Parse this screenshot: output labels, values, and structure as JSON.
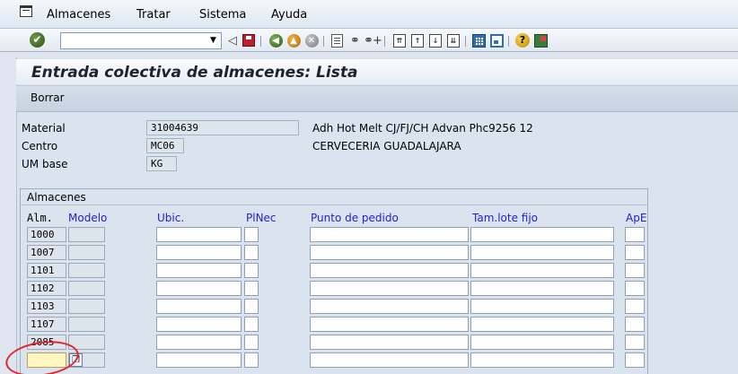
{
  "menu": {
    "items": [
      "Almacenes",
      "Tratar",
      "Sistema",
      "Ayuda"
    ]
  },
  "toolbar": {
    "command_field": "",
    "icons": [
      "enter-icon",
      "back-triangle-icon",
      "save-icon",
      "back-icon",
      "exit-icon",
      "cancel-icon",
      "print-icon",
      "find-icon",
      "find-next-icon",
      "first-page-icon",
      "previous-page-icon",
      "next-page-icon",
      "last-page-icon",
      "create-session-icon",
      "shortcut-icon",
      "help-icon",
      "layout-icon"
    ]
  },
  "page": {
    "title": "Entrada colectiva de almacenes: Lista",
    "borrar_label": "Borrar"
  },
  "header": {
    "material_label": "Material",
    "material_value": "31004639",
    "material_desc": "Adh Hot Melt CJ/FJ/CH Advan Phc9256 12",
    "centro_label": "Centro",
    "centro_value": "MC06",
    "centro_desc": "CERVECERIA GUADALAJARA",
    "um_label": "UM base",
    "um_value": "KG"
  },
  "table": {
    "group_title": "Almacenes",
    "columns": [
      "Alm.",
      "Modelo",
      "Ubic.",
      "PlNec",
      "Punto de pedido",
      "Tam.lote fijo",
      "ApE"
    ],
    "rows": [
      "1000",
      "1007",
      "1101",
      "1102",
      "1103",
      "1107",
      "2085",
      ""
    ]
  }
}
